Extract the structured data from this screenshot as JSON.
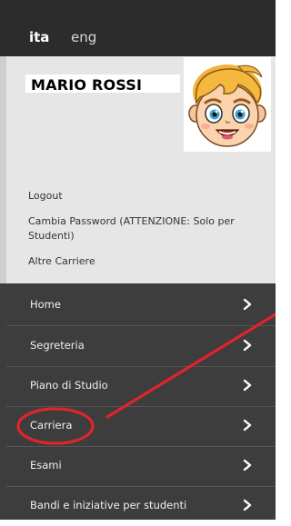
{
  "language": {
    "active": "ita",
    "other": "eng"
  },
  "profile": {
    "name": "MARIO ROSSI",
    "avatar": "cartoon-boy-avatar",
    "links": {
      "logout": "Logout",
      "change_password": "Cambia Password (ATTENZIONE: Solo per Studenti)",
      "other_careers": "Altre Carriere"
    }
  },
  "nav": {
    "items": [
      {
        "label": "Home",
        "icon": "chevron-right-icon"
      },
      {
        "label": "Segreteria",
        "icon": "chevron-right-icon"
      },
      {
        "label": "Piano di Studio",
        "icon": "chevron-right-icon"
      },
      {
        "label": "Carriera",
        "icon": "chevron-right-icon"
      },
      {
        "label": "Esami",
        "icon": "chevron-right-icon"
      },
      {
        "label": "Bandi e iniziative per studenti",
        "icon": "chevron-right-icon"
      }
    ]
  },
  "annotation": {
    "highlighted_item": "Carriera",
    "color": "#e0242b"
  },
  "colors": {
    "topbar": "#2c2c2c",
    "profile_bg": "#e6e6e6",
    "nav_bg": "#3d3d3d",
    "nav_accent": "#1c4f7c"
  }
}
